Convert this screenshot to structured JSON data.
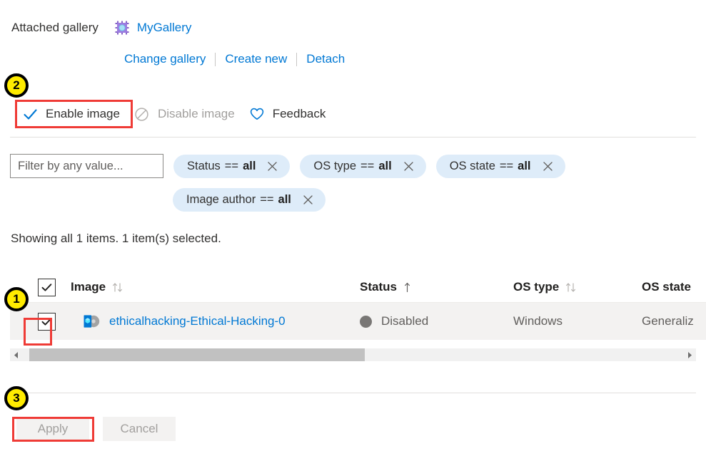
{
  "gallery": {
    "label": "Attached gallery",
    "icon": "gallery-chip-icon",
    "name": "MyGallery",
    "links": [
      {
        "label": "Change gallery"
      },
      {
        "label": "Create new"
      },
      {
        "label": "Detach"
      }
    ]
  },
  "commandbar": {
    "items": [
      {
        "label": "Enable image",
        "icon": "checkmark-icon",
        "disabled": false
      },
      {
        "label": "Disable image",
        "icon": "block-circle-icon",
        "disabled": true
      },
      {
        "label": "Feedback",
        "icon": "heart-icon",
        "disabled": false
      }
    ]
  },
  "filters": {
    "search_placeholder": "Filter by any value...",
    "search_value": "",
    "pills": [
      {
        "name": "Status",
        "operator": "==",
        "value": "all"
      },
      {
        "name": "OS type",
        "operator": "==",
        "value": "all"
      },
      {
        "name": "OS state",
        "operator": "==",
        "value": "all"
      },
      {
        "name": "Image author",
        "operator": "==",
        "value": "all"
      }
    ]
  },
  "summary": {
    "text": "Showing all 1 items.  1 item(s) selected."
  },
  "table": {
    "columns": [
      {
        "key": "image",
        "label": "Image",
        "sort": "both"
      },
      {
        "key": "status",
        "label": "Status",
        "sort": "asc"
      },
      {
        "key": "ostype",
        "label": "OS type",
        "sort": "both"
      },
      {
        "key": "osstate",
        "label": "OS state",
        "sort": "none"
      }
    ],
    "header_checkbox_checked": true,
    "rows": [
      {
        "checked": true,
        "icon": "vm-image-icon",
        "image": "ethicalhacking-Ethical-Hacking-0",
        "status": "Disabled",
        "status_color": "#797775",
        "ostype": "Windows",
        "osstate": "Generaliz"
      }
    ]
  },
  "scrollbar": {
    "left_arrow": "chevron-left-icon",
    "right_arrow": "chevron-right-icon"
  },
  "footer": {
    "apply_label": "Apply",
    "cancel_label": "Cancel"
  },
  "annotations": {
    "badges": [
      {
        "number": "1"
      },
      {
        "number": "2"
      },
      {
        "number": "3"
      }
    ],
    "highlight_color": "#ef3b36",
    "badge_color": "#ffeb00"
  }
}
